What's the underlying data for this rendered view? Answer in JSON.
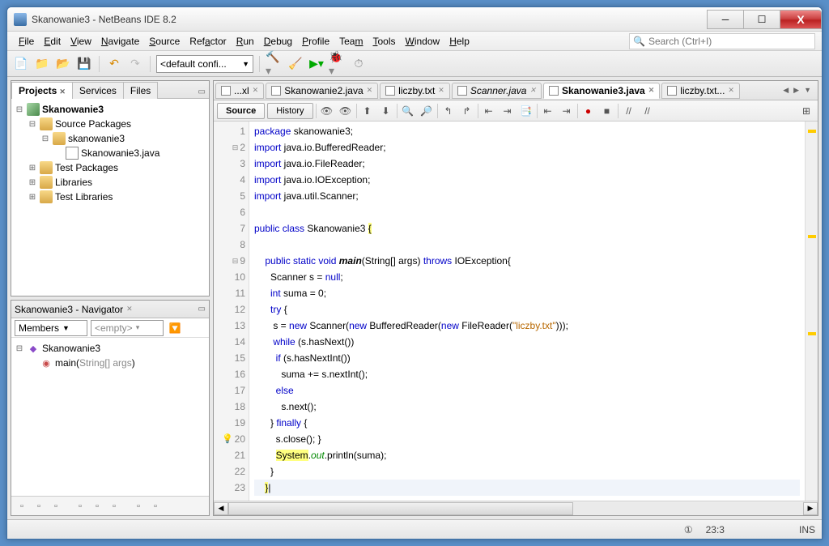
{
  "window": {
    "title": "Skanowanie3 - NetBeans IDE 8.2"
  },
  "menu": {
    "items": [
      "File",
      "Edit",
      "View",
      "Navigate",
      "Source",
      "Refactor",
      "Run",
      "Debug",
      "Profile",
      "Team",
      "Tools",
      "Window",
      "Help"
    ]
  },
  "search": {
    "placeholder": "Search (Ctrl+I)"
  },
  "toolbar": {
    "config": "<default confi..."
  },
  "projects": {
    "tabs": [
      "Projects",
      "Services",
      "Files"
    ],
    "tree": [
      {
        "indent": 0,
        "exp": "⊟",
        "icon": "cube",
        "label": "Skanowanie3",
        "bold": true
      },
      {
        "indent": 1,
        "exp": "⊟",
        "icon": "pkg",
        "label": "Source Packages"
      },
      {
        "indent": 2,
        "exp": "⊟",
        "icon": "pkg",
        "label": "skanowanie3"
      },
      {
        "indent": 3,
        "exp": "",
        "icon": "java",
        "label": "Skanowanie3.java"
      },
      {
        "indent": 1,
        "exp": "⊞",
        "icon": "pkg",
        "label": "Test Packages"
      },
      {
        "indent": 1,
        "exp": "⊞",
        "icon": "pkg",
        "label": "Libraries"
      },
      {
        "indent": 1,
        "exp": "⊞",
        "icon": "pkg",
        "label": "Test Libraries"
      }
    ]
  },
  "navigator": {
    "title": "Skanowanie3 - Navigator",
    "combo1": "Members",
    "combo2": "<empty>",
    "tree": [
      {
        "indent": 0,
        "exp": "⊟",
        "icon": "class",
        "label": "Skanowanie3"
      },
      {
        "indent": 1,
        "exp": "",
        "icon": "method",
        "label": "main(",
        "param": "String[] args",
        "close": ")"
      }
    ]
  },
  "editor": {
    "tabs": [
      {
        "label": "...xl",
        "icon": "txt",
        "active": false,
        "italic": false
      },
      {
        "label": "Skanowanie2.java",
        "icon": "java",
        "active": false,
        "italic": false
      },
      {
        "label": "liczby.txt",
        "icon": "txt",
        "active": false,
        "italic": false
      },
      {
        "label": "Scanner.java",
        "icon": "java",
        "active": false,
        "italic": true
      },
      {
        "label": "Skanowanie3.java",
        "icon": "java",
        "active": true,
        "italic": false
      },
      {
        "label": "liczby.txt...",
        "icon": "txt",
        "active": false,
        "italic": false
      }
    ],
    "subtabs": {
      "source": "Source",
      "history": "History"
    },
    "lines": 23
  },
  "status": {
    "pos": "23:3",
    "mode": "INS"
  }
}
